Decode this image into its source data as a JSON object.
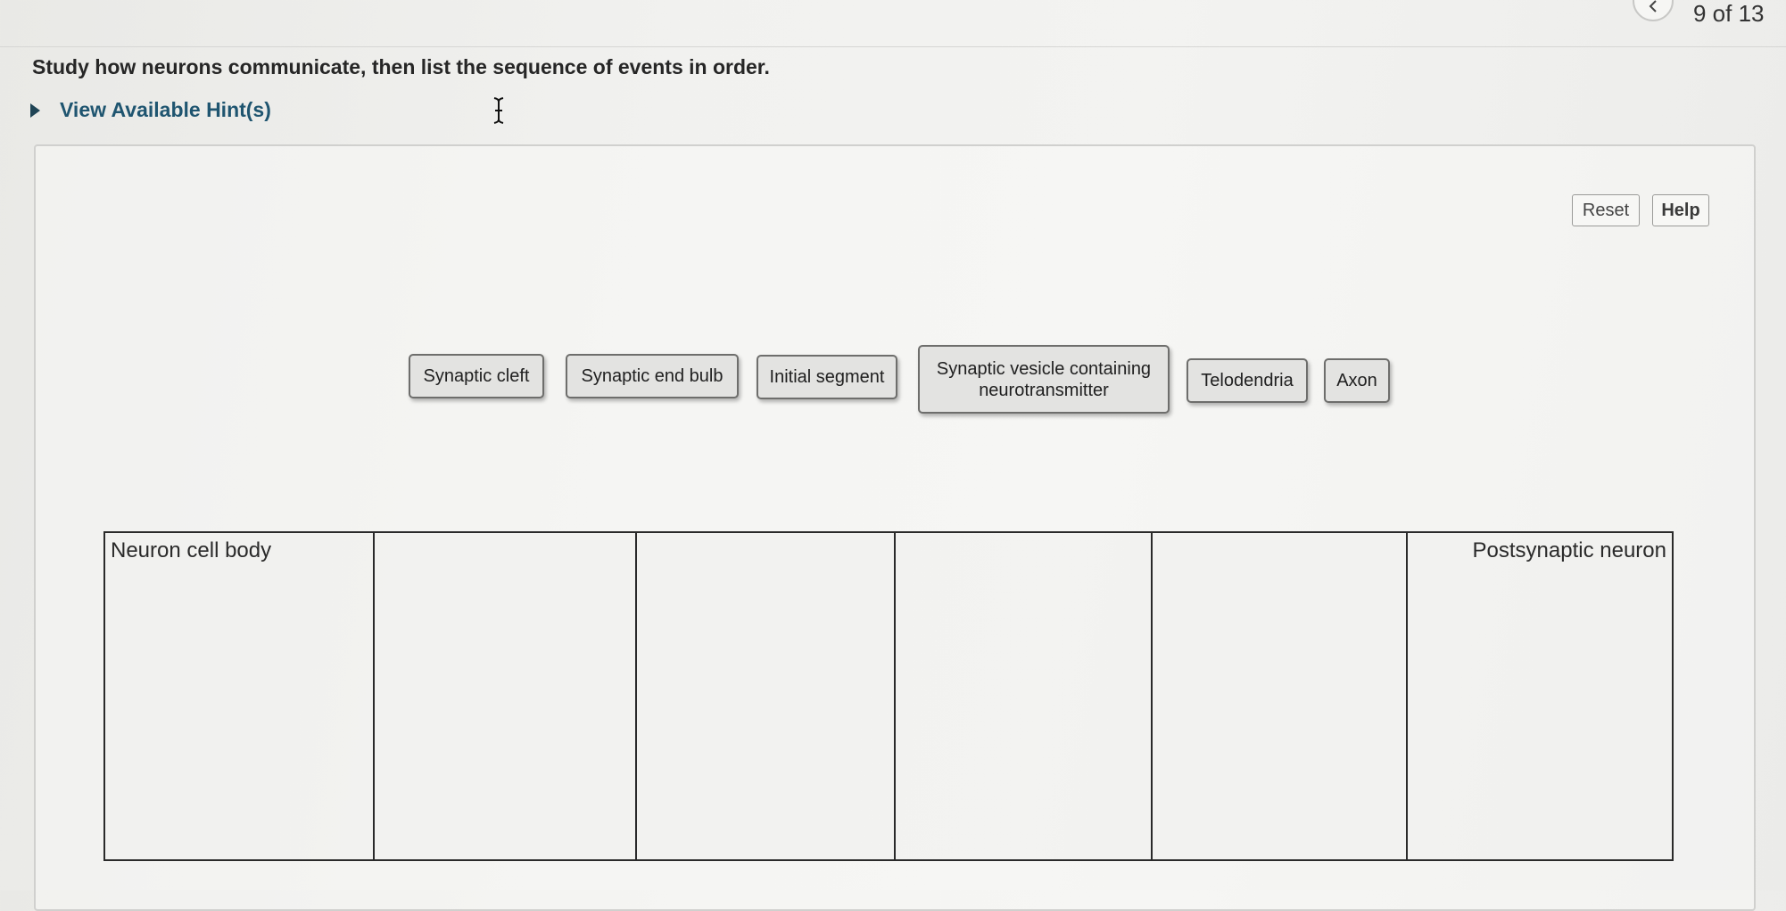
{
  "navigation": {
    "prev_icon": "chevron-left-icon",
    "counter": "9 of 13"
  },
  "question": {
    "prompt": "Study how neurons communicate, then list the sequence of events in order.",
    "hint_toggle": "View Available Hint(s)"
  },
  "toolbar": {
    "reset_label": "Reset",
    "help_label": "Help"
  },
  "labels": [
    "Synaptic cleft",
    "Synaptic end bulb",
    "Initial segment",
    "Synaptic vesicle containing neurotransmitter",
    "Telodendria",
    "Axon"
  ],
  "sequence": {
    "start_label": "Neuron cell body",
    "end_label": "Postsynaptic neuron"
  },
  "colors": {
    "hint_text": "#1f5570",
    "tile_fill": "#e3e3e1",
    "tile_border": "#6e6e6c",
    "table_border": "#2a2a2a"
  }
}
